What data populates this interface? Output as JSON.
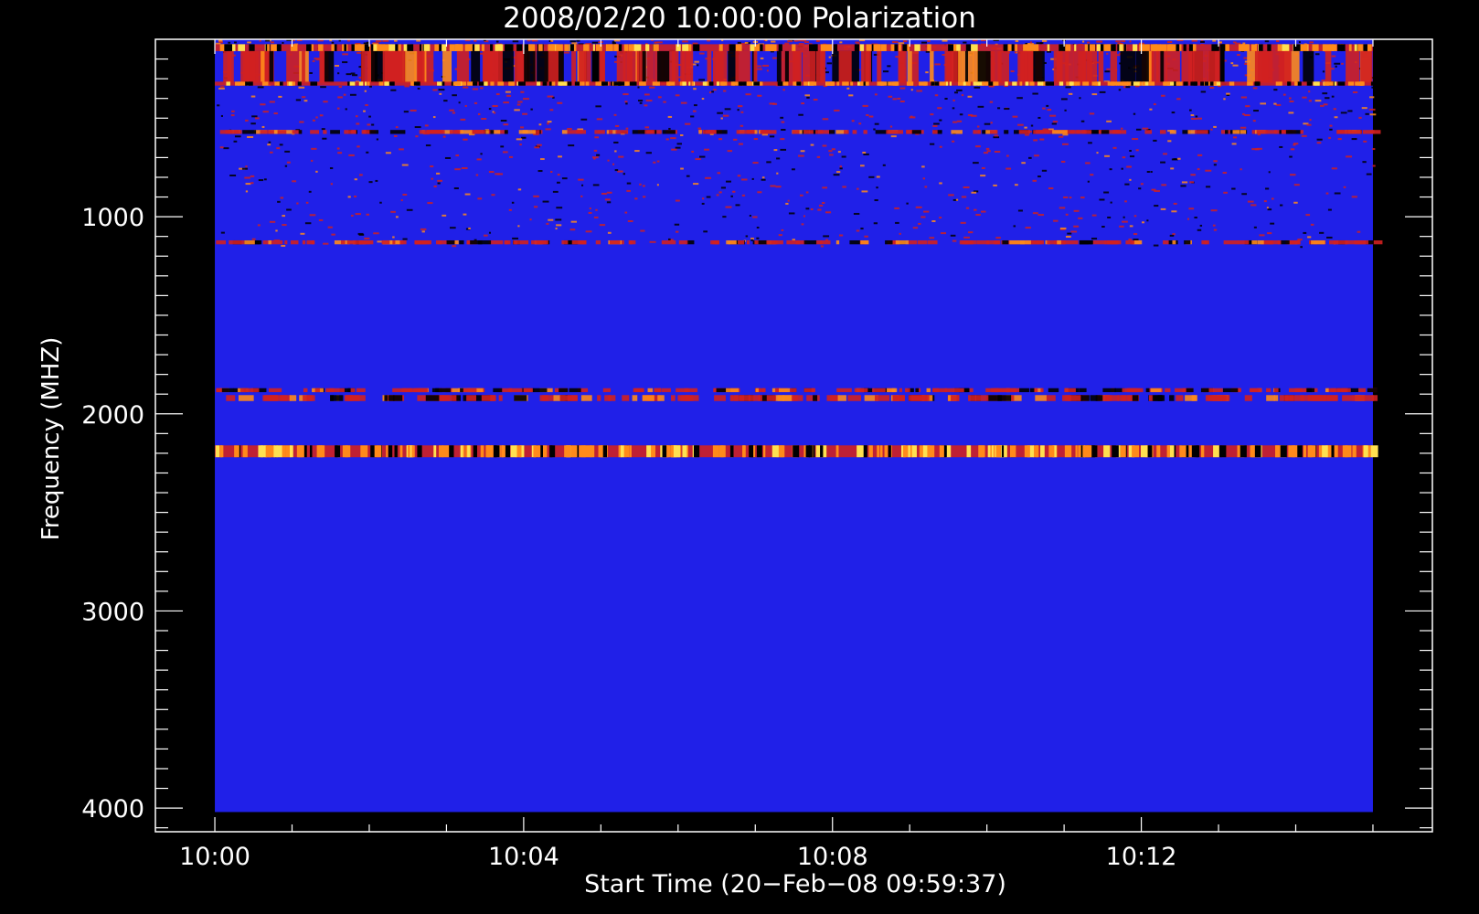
{
  "chart_data": {
    "type": "heatmap",
    "title": "2008/02/20 10:00:00 Polarization",
    "xlabel": "Start Time (20−Feb−08 09:59:37)",
    "ylabel": "Frequency (MHZ)",
    "x_tick_labels": [
      "10:00",
      "10:04",
      "10:08",
      "10:12"
    ],
    "x_tick_minutes": [
      0,
      4,
      8,
      12
    ],
    "x_range_minutes": [
      -0.77,
      15.77
    ],
    "data_time_range_minutes": [
      0,
      15
    ],
    "y_tick_values": [
      1000,
      2000,
      3000,
      4000
    ],
    "y_range": [
      100,
      4120
    ],
    "data_freq_range": [
      100,
      4020
    ],
    "y_reversed": true,
    "grid": false,
    "colors": {
      "background": "#000000",
      "axes": "#ffffff",
      "base": "#2020e8",
      "mid": "#d02020",
      "high": "#ff8a1a",
      "peak": "#ffe050"
    },
    "bands": [
      {
        "freq_from": 125,
        "freq_to": 160,
        "level": "high"
      },
      {
        "freq_from": 160,
        "freq_to": 320,
        "level": "mixed"
      },
      {
        "freq_from": 315,
        "freq_to": 335,
        "level": "high"
      },
      {
        "freq_from": 560,
        "freq_to": 580,
        "level": "mid"
      },
      {
        "freq_from": 1120,
        "freq_to": 1140,
        "level": "mixed"
      },
      {
        "freq_from": 1870,
        "freq_to": 1890,
        "level": "mid"
      },
      {
        "freq_from": 1905,
        "freq_to": 1935,
        "level": "mixed"
      },
      {
        "freq_from": 2160,
        "freq_to": 2220,
        "level": "high"
      }
    ]
  }
}
